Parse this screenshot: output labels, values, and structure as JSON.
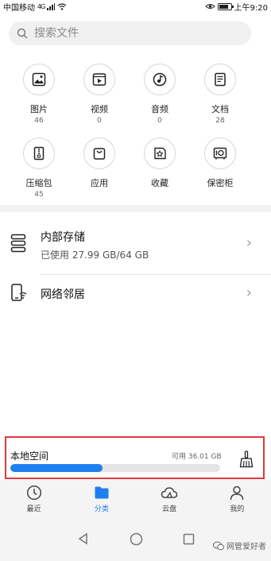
{
  "status_bar": {
    "carrier": "中国移动",
    "network": "4G",
    "time": "上午9:20"
  },
  "search": {
    "placeholder": "搜索文件"
  },
  "categories": [
    {
      "label": "图片",
      "count": "46",
      "icon": "image-icon"
    },
    {
      "label": "视频",
      "count": "0",
      "icon": "video-icon"
    },
    {
      "label": "音频",
      "count": "0",
      "icon": "audio-icon"
    },
    {
      "label": "文档",
      "count": "28",
      "icon": "document-icon"
    },
    {
      "label": "压缩包",
      "count": "45",
      "icon": "archive-icon"
    },
    {
      "label": "应用",
      "count": "",
      "icon": "app-bag-icon"
    },
    {
      "label": "收藏",
      "count": "",
      "icon": "favorite-icon"
    },
    {
      "label": "保密柜",
      "count": "",
      "icon": "safe-icon"
    }
  ],
  "storage_list": [
    {
      "title": "内部存储",
      "subtitle": "已使用 27.99 GB/64 GB",
      "icon": "storage-icon"
    },
    {
      "title": "网络邻居",
      "subtitle": "",
      "icon": "network-neighbor-icon"
    }
  ],
  "local_space": {
    "title": "本地空间",
    "available": "可用 36.01 GB",
    "used_fraction": 0.4375,
    "icon": "broom-icon",
    "fill_color": "#1f7ff0",
    "highlight_color": "#e0393e"
  },
  "tabs": [
    {
      "label": "最近",
      "icon": "clock-icon",
      "active": false
    },
    {
      "label": "分类",
      "icon": "folder-icon",
      "active": true
    },
    {
      "label": "云盘",
      "icon": "cloud-icon",
      "active": false
    },
    {
      "label": "我的",
      "icon": "person-icon",
      "active": false
    }
  ],
  "watermark": "网管爱好者",
  "colors": {
    "accent": "#1f7ff0"
  }
}
